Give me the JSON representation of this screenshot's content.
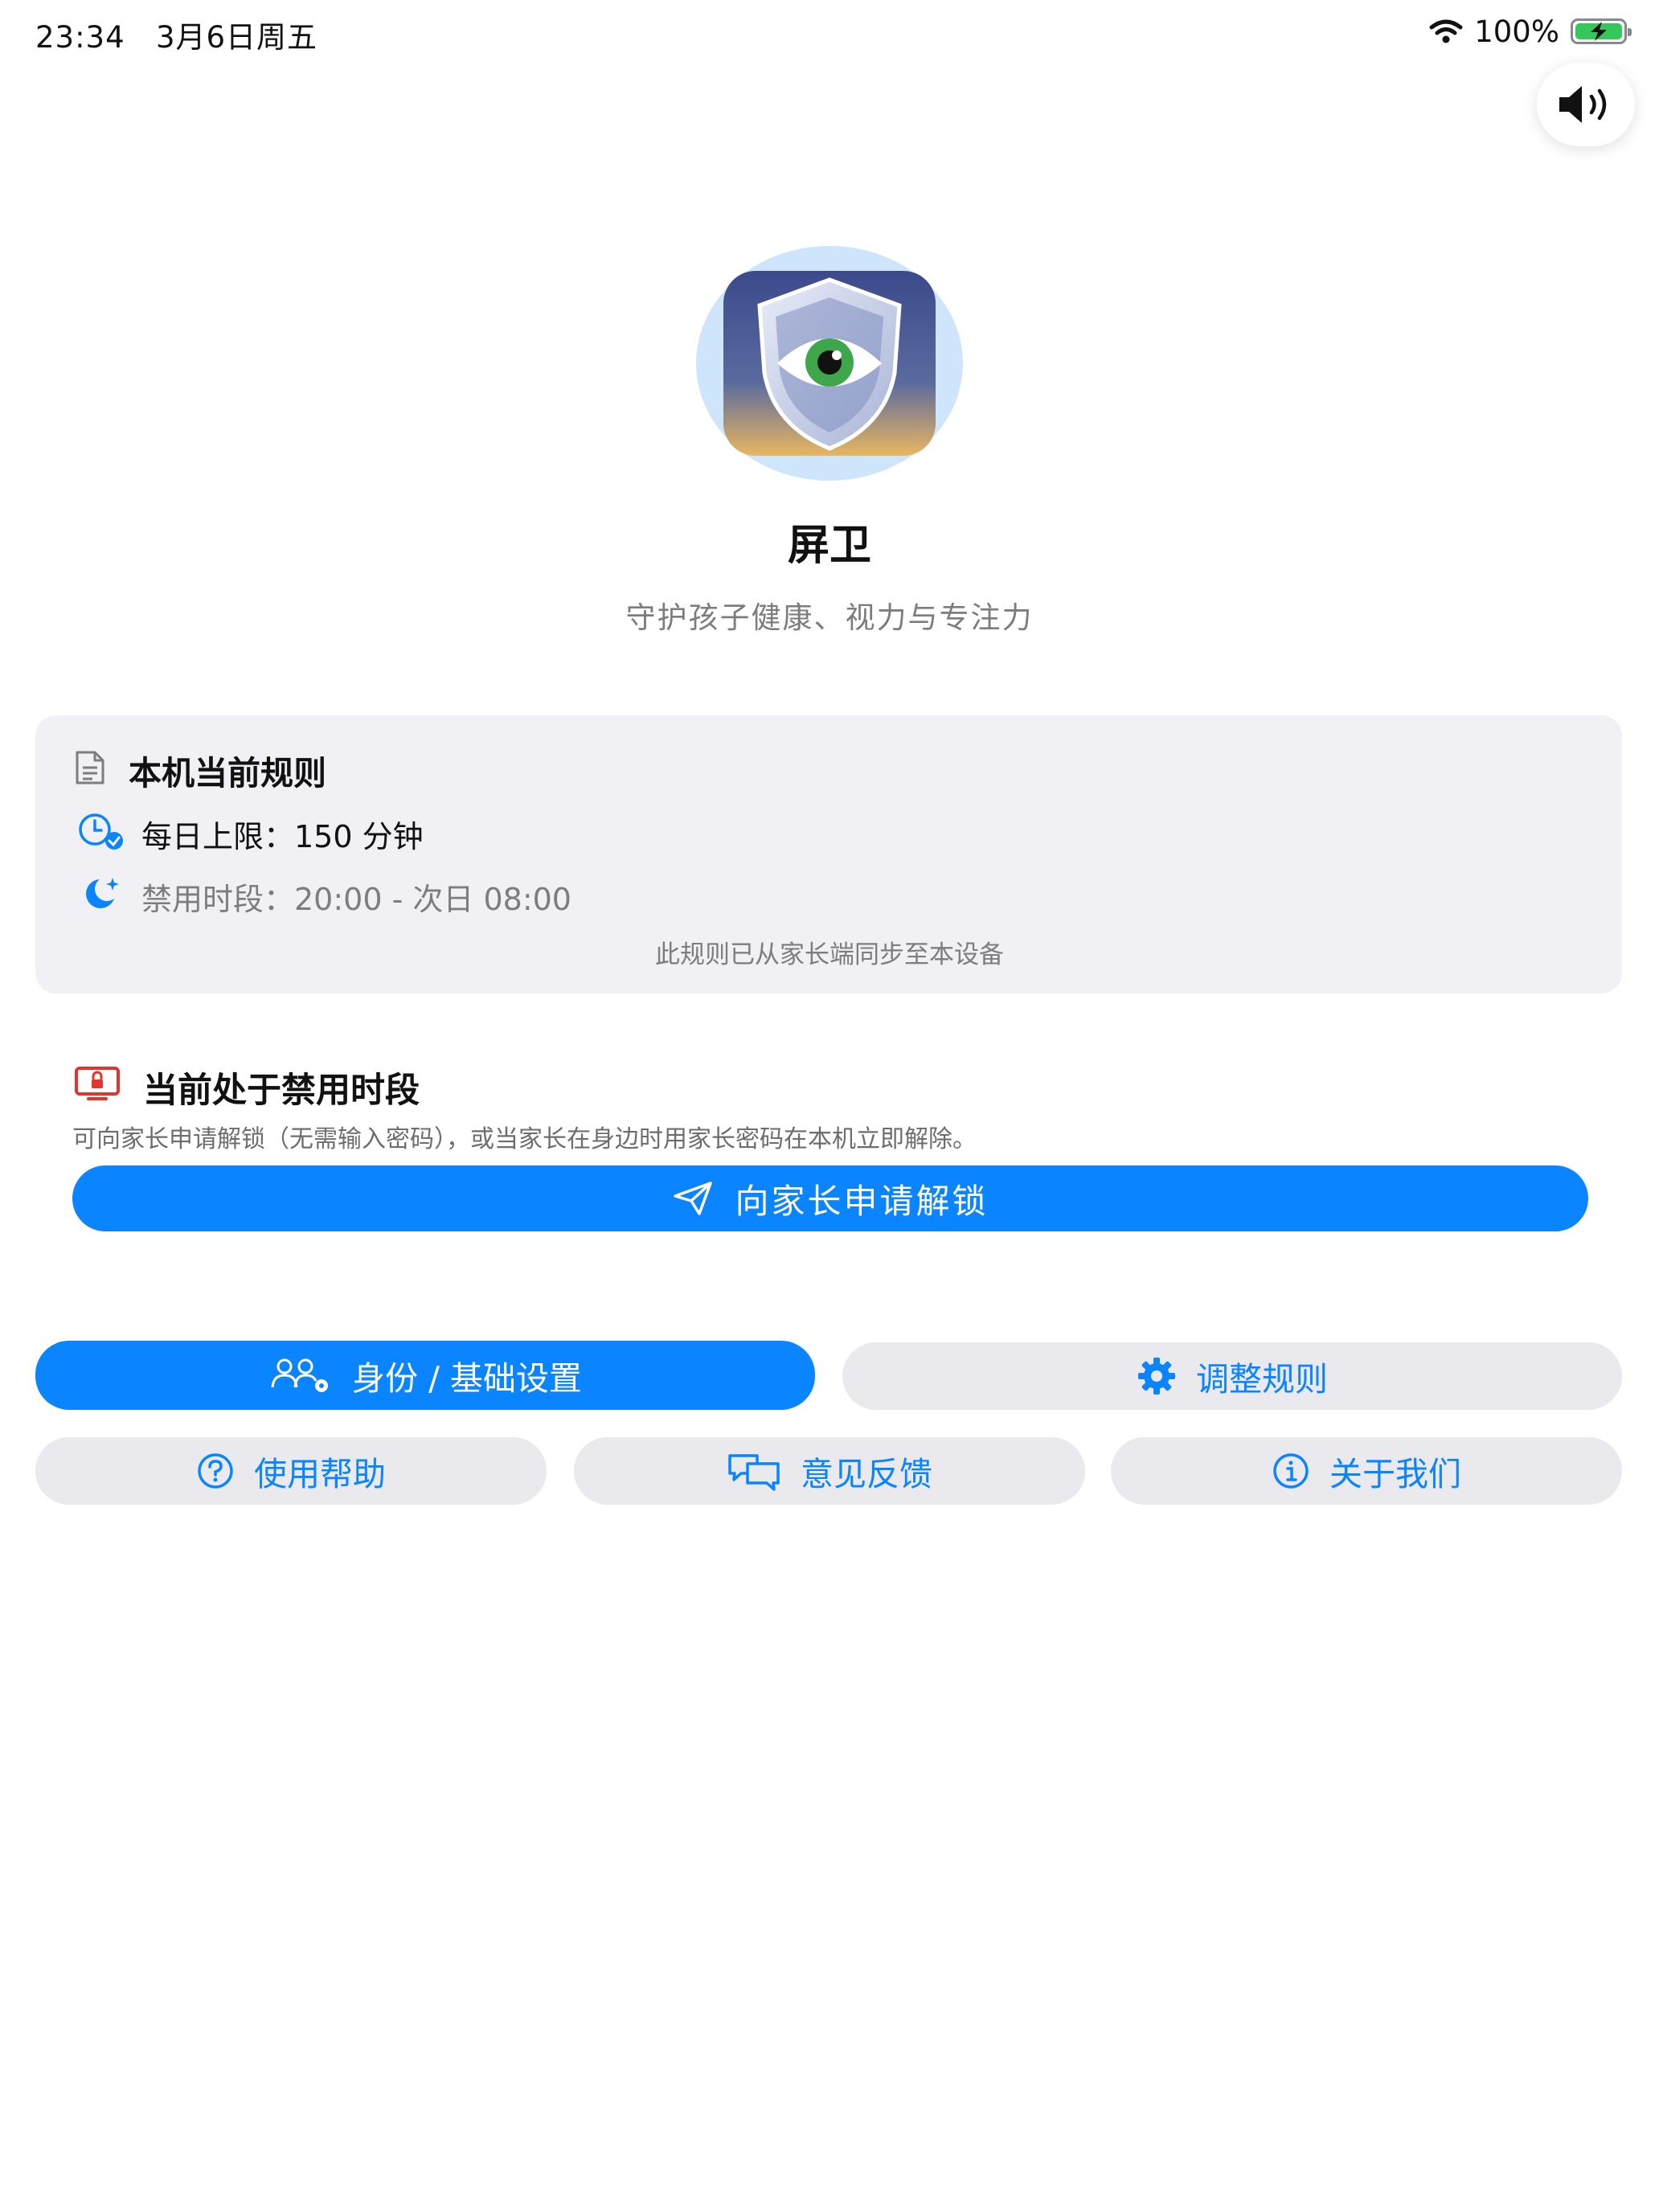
{
  "status_bar": {
    "time": "23:34",
    "date": "3月6日周五",
    "battery": "100%",
    "icons": [
      "wifi-icon",
      "battery-charging-icon"
    ]
  },
  "sound_toggle": {
    "icon": "speaker-icon"
  },
  "app": {
    "name": "屏卫",
    "tagline": "守护孩子健康、视力与专注力",
    "logo_icon": "shield-eye-icon"
  },
  "rules": {
    "title": "本机当前规则",
    "daily_limit": "每日上限：150 分钟",
    "banned_period": "禁用时段：20:00 - 次日 08:00",
    "note": "此规则已从家长端同步至本设备",
    "icons": [
      "document-icon",
      "clock-check-icon",
      "moon-stars-icon"
    ]
  },
  "ban_status": {
    "title": "当前处于禁用时段",
    "description": "可向家长申请解锁（无需输入密码），或当家长在身边时用家长密码在本机立即解除。",
    "unlock_button": "向家长申请解锁",
    "icons": [
      "locked-screen-icon",
      "send-icon"
    ]
  },
  "actions": {
    "identity": "身份 / 基础设置",
    "adjust_rules": "调整规则",
    "help": "使用帮助",
    "feedback": "意见反馈",
    "about": "关于我们"
  },
  "colors": {
    "accent": "#0a84ff",
    "card_bg": "#f0f0f5",
    "button_gray": "#e9e9ee",
    "alert_red": "#e5342c",
    "secondary_text": "#7d7d7d"
  }
}
